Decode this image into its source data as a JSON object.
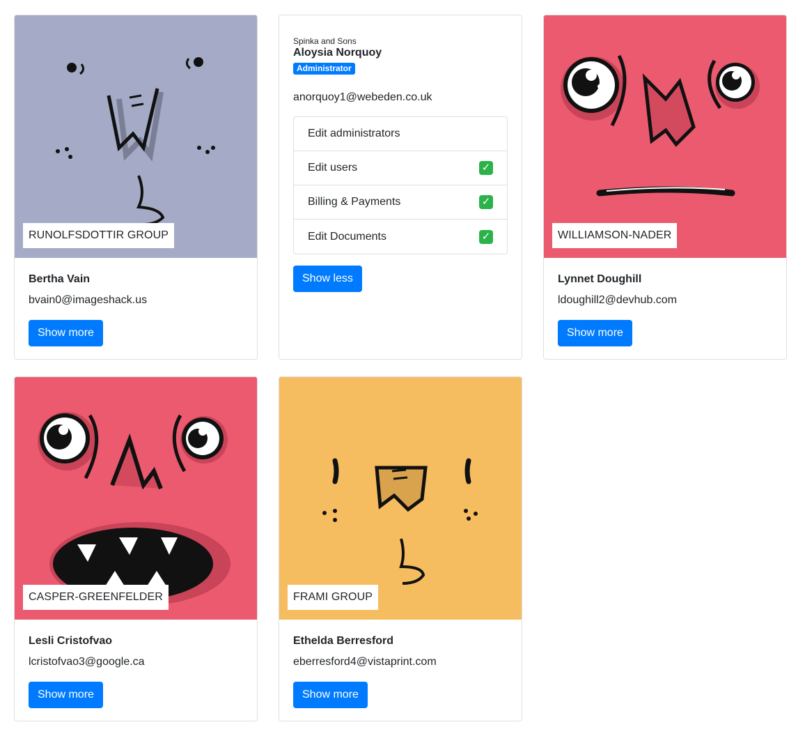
{
  "colors": {
    "primary": "#007bff",
    "avatar_gray": "#a5abc6",
    "avatar_red": "#ec5a6f",
    "avatar_yellow": "#f5bd5f",
    "check_green": "#2bb34a"
  },
  "cards": [
    {
      "company": "RUNOLFSDOTTIR GROUP",
      "name": "Bertha Vain",
      "email": "bvain0@imageshack.us",
      "button": "Show more"
    },
    {
      "company": "Spinka and Sons",
      "name": "Aloysia Norquoy",
      "role": "Administrator",
      "email": "anorquoy1@webeden.co.uk",
      "permissions": [
        {
          "label": "Edit administrators",
          "checked": false
        },
        {
          "label": "Edit users",
          "checked": true
        },
        {
          "label": "Billing & Payments",
          "checked": true
        },
        {
          "label": "Edit Documents",
          "checked": true
        }
      ],
      "check_glyph": "✓",
      "button": "Show less"
    },
    {
      "company": "WILLIAMSON-NADER",
      "name": "Lynnet Doughill",
      "email": "ldoughill2@devhub.com",
      "button": "Show more"
    },
    {
      "company": "CASPER-GREENFELDER",
      "name": "Lesli Cristofvao",
      "email": "lcristofvao3@google.ca",
      "button": "Show more"
    },
    {
      "company": "FRAMI GROUP",
      "name": "Ethelda Berresford",
      "email": "eberresford4@vistaprint.com",
      "button": "Show more"
    }
  ]
}
